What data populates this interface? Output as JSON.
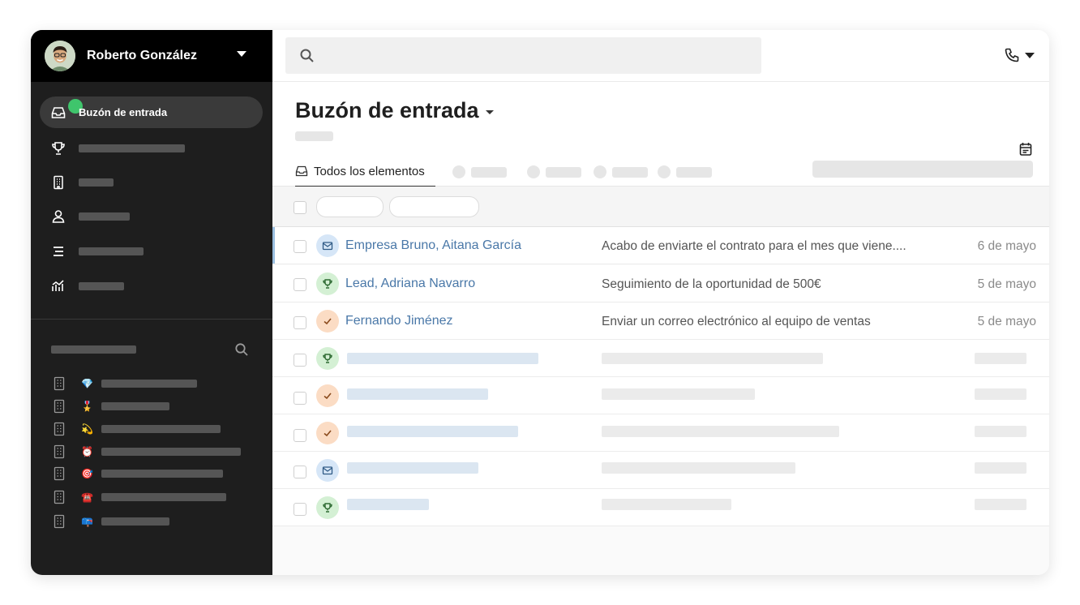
{
  "user": {
    "name": "Roberto González"
  },
  "sidebar": {
    "items": [
      {
        "label": "Buzón de entrada",
        "icon": "inbox-icon",
        "active": true
      },
      {
        "label": "",
        "icon": "trophy-icon"
      },
      {
        "label": "",
        "icon": "building-icon"
      },
      {
        "label": "",
        "icon": "person-icon"
      },
      {
        "label": "",
        "icon": "list-icon"
      },
      {
        "label": "",
        "icon": "chart-icon"
      }
    ],
    "saved_lists": [
      {
        "emoji": "💎",
        "icon": "gem-icon"
      },
      {
        "emoji": "🎖️",
        "icon": "medal-icon"
      },
      {
        "emoji": "💫",
        "icon": "dizzy-star-icon"
      },
      {
        "emoji": "⏰",
        "icon": "alarm-clock-icon"
      },
      {
        "emoji": "🎯",
        "icon": "target-icon"
      },
      {
        "emoji": "☎️",
        "icon": "telephone-icon"
      },
      {
        "emoji": "📪",
        "icon": "mailbox-icon"
      }
    ]
  },
  "header": {
    "title": "Buzón de entrada"
  },
  "tabs": [
    {
      "label": "Todos los elementos",
      "active": true
    }
  ],
  "rows": [
    {
      "type": "email",
      "name": "Empresa Bruno, Aitana García",
      "subject": "Acabo de enviarte el contrato para el mes que viene....",
      "date": "6 de mayo",
      "selected": true
    },
    {
      "type": "deal",
      "name": "Lead, Adriana Navarro",
      "subject": "Seguimiento de la oportunidad de 500€",
      "date": "5 de mayo"
    },
    {
      "type": "task",
      "name": "Fernando Jiménez",
      "subject": "Enviar un correo electrónico al equipo de ventas",
      "date": "5 de mayo"
    },
    {
      "type": "deal",
      "name": "",
      "subject": "",
      "date": ""
    },
    {
      "type": "task",
      "name": "",
      "subject": "",
      "date": ""
    },
    {
      "type": "task",
      "name": "",
      "subject": "",
      "date": ""
    },
    {
      "type": "email",
      "name": "",
      "subject": "",
      "date": ""
    },
    {
      "type": "deal",
      "name": "",
      "subject": "",
      "date": ""
    }
  ],
  "colors": {
    "sidebar_bg": "#1e1e1e",
    "accent_green": "#3fc56c",
    "link_blue": "#4a78a8",
    "email_badge": "#d6e6f7",
    "deal_badge": "#d4f0d4",
    "task_badge": "#fbdcc4"
  }
}
